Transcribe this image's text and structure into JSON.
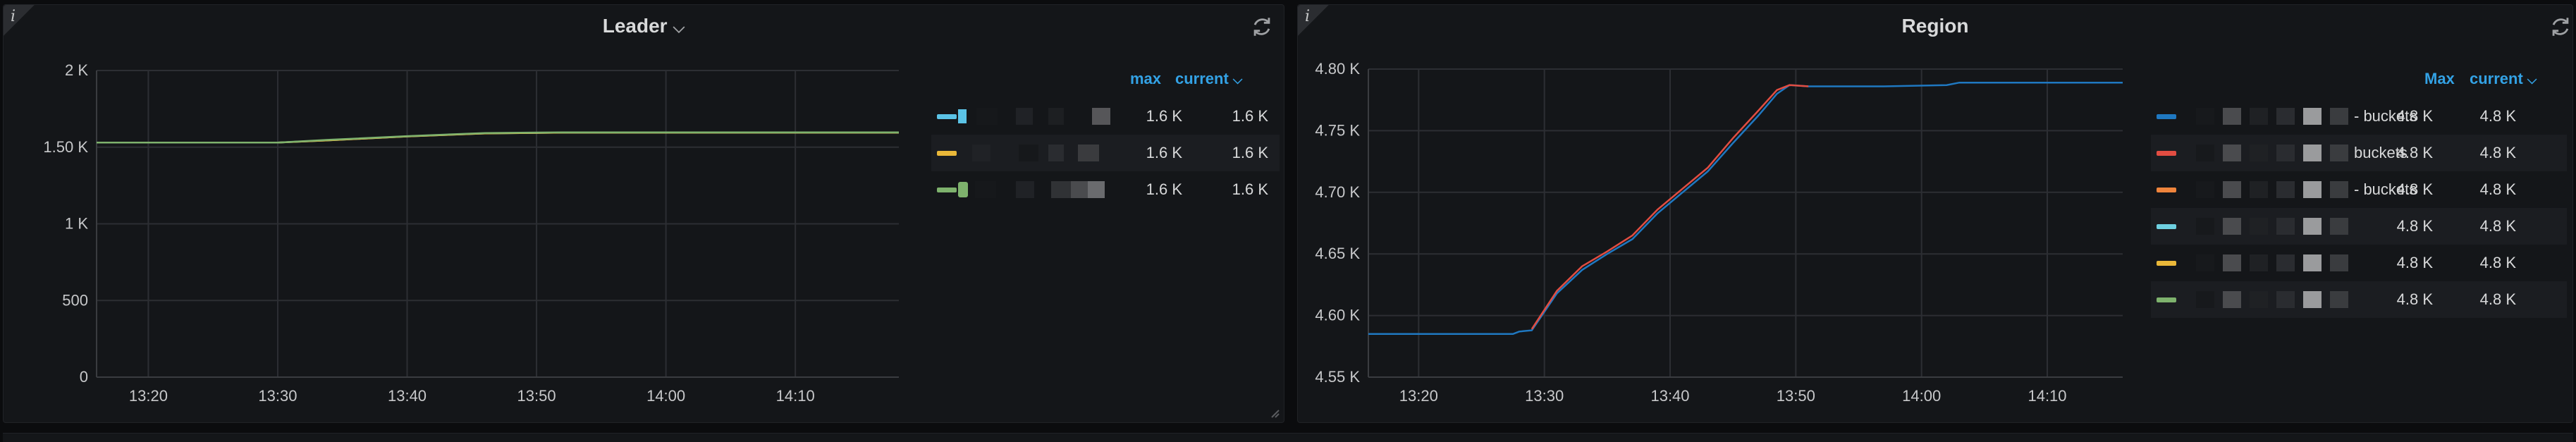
{
  "panels": {
    "leader": {
      "title": "Leader",
      "legend": {
        "headers": {
          "max": "max",
          "current": "current"
        },
        "rows": [
          {
            "color": "#5bc3e6",
            "max": "1.6 K",
            "current": "1.6 K"
          },
          {
            "color": "#eab839",
            "max": "1.6 K",
            "current": "1.6 K"
          },
          {
            "color": "#7eb26d",
            "max": "1.6 K",
            "current": "1.6 K"
          }
        ]
      }
    },
    "region": {
      "title": "Region",
      "legend": {
        "headers": {
          "max": "Max",
          "current": "current"
        },
        "rows": [
          {
            "color": "#1f78c1",
            "suffix": "- buckets",
            "max": "4.8 K",
            "current": "4.8 K"
          },
          {
            "color": "#e24d42",
            "suffix": "buckets",
            "max": "4.8 K",
            "current": "4.8 K"
          },
          {
            "color": "#ef843c",
            "suffix": "- buckets",
            "max": "4.8 K",
            "current": "4.8 K"
          },
          {
            "color": "#6ed0e0",
            "suffix": "",
            "max": "4.8 K",
            "current": "4.8 K"
          },
          {
            "color": "#eab839",
            "suffix": "",
            "max": "4.8 K",
            "current": "4.8 K"
          },
          {
            "color": "#7eb26d",
            "suffix": "",
            "max": "4.8 K",
            "current": "4.8 K"
          }
        ]
      }
    }
  },
  "icons": {
    "info": "info-icon",
    "refresh": "refresh-icon",
    "chevron": "chevron-down-icon"
  },
  "chart_data": [
    {
      "type": "line",
      "title": "Leader",
      "x_ticks": [
        "13:20",
        "13:30",
        "13:40",
        "13:50",
        "14:00",
        "14:10"
      ],
      "y_ticks": [
        "0",
        "500",
        "1 K",
        "1.50 K",
        "2 K"
      ],
      "ylim": [
        0,
        2000
      ],
      "xlim_minutes_from_1316": [
        0,
        62
      ],
      "series": [
        {
          "color": "#5bc3e6",
          "points": [
            [
              0,
              1530
            ],
            [
              14,
              1530
            ],
            [
              18,
              1545
            ],
            [
              24,
              1570
            ],
            [
              30,
              1590
            ],
            [
              36,
              1595
            ],
            [
              62,
              1595
            ]
          ]
        },
        {
          "color": "#eab839",
          "points": [
            [
              0,
              1530
            ],
            [
              14,
              1530
            ],
            [
              18,
              1545
            ],
            [
              24,
              1570
            ],
            [
              30,
              1590
            ],
            [
              36,
              1595
            ],
            [
              62,
              1595
            ]
          ]
        },
        {
          "color": "#7eb26d",
          "points": [
            [
              0,
              1530
            ],
            [
              14,
              1530
            ],
            [
              18,
              1548
            ],
            [
              24,
              1572
            ],
            [
              30,
              1592
            ],
            [
              36,
              1597
            ],
            [
              62,
              1597
            ]
          ]
        }
      ]
    },
    {
      "type": "line",
      "title": "Region",
      "x_ticks": [
        "13:20",
        "13:30",
        "13:40",
        "13:50",
        "14:00",
        "14:10"
      ],
      "y_ticks": [
        "4.55 K",
        "4.60 K",
        "4.65 K",
        "4.70 K",
        "4.75 K",
        "4.80 K"
      ],
      "ylim": [
        4550,
        4800
      ],
      "xlim_minutes_from_1316": [
        0,
        60
      ],
      "series": [
        {
          "color": "#1f78c1",
          "points": [
            [
              0,
              4585
            ],
            [
              11.5,
              4585
            ],
            [
              12,
              4587
            ],
            [
              13,
              4588
            ],
            [
              15,
              4618
            ],
            [
              17,
              4637
            ],
            [
              19,
              4650
            ],
            [
              21,
              4662
            ],
            [
              23,
              4683
            ],
            [
              25,
              4700
            ],
            [
              27,
              4717
            ],
            [
              29,
              4740
            ],
            [
              31,
              4762
            ],
            [
              32.5,
              4780
            ],
            [
              33.5,
              4787
            ],
            [
              35,
              4786
            ],
            [
              41,
              4786
            ],
            [
              46,
              4787
            ],
            [
              47,
              4789
            ],
            [
              60,
              4789
            ]
          ]
        },
        {
          "color": "#e24d42",
          "points": [
            [
              13,
              4589
            ],
            [
              15,
              4620
            ],
            [
              17,
              4640
            ],
            [
              19,
              4652
            ],
            [
              21,
              4665
            ],
            [
              23,
              4686
            ],
            [
              25,
              4703
            ],
            [
              27,
              4720
            ],
            [
              29,
              4744
            ],
            [
              31,
              4766
            ],
            [
              32.5,
              4783
            ],
            [
              33.5,
              4787
            ],
            [
              35,
              4786
            ]
          ]
        }
      ]
    }
  ]
}
